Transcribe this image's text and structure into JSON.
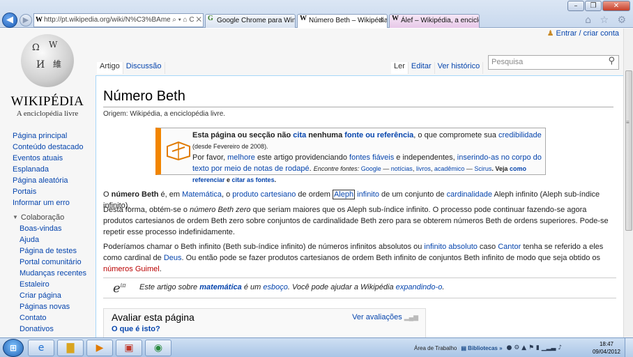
{
  "browser": {
    "address": "http://pt.wikipedia.org/wiki/N%C3%BAmero_Be",
    "address_controls": "⌕ ▾ ⌂ C ✕",
    "tabs": [
      {
        "label": "Google Chrome para Window...",
        "icon": "G"
      },
      {
        "label": "Número Beth – Wikipédia, ...",
        "icon": "W",
        "close": "✕"
      },
      {
        "label": "Álef – Wikipédia, a enciclopédi...",
        "icon": "W"
      }
    ],
    "toolbar_icons": "⌂ ☆ ⚙"
  },
  "wiki": {
    "wordmark": "WIKIPÉDIA",
    "tagline": "A enciclopédia livre",
    "user_link": "Entrar / criar conta",
    "left_tabs": [
      "Artigo",
      "Discussão"
    ],
    "right_tabs": [
      "Ler",
      "Editar",
      "Ver histórico"
    ],
    "search_placeholder": "Pesquisa",
    "sidebar": {
      "main": [
        "Página principal",
        "Conteúdo destacado",
        "Eventos atuais",
        "Esplanada",
        "Página aleatória",
        "Portais",
        "Informar um erro"
      ],
      "collab_header": "Colaboração",
      "collab": [
        "Boas-vindas",
        "Ajuda",
        "Página de testes",
        "Portal comunitário",
        "Mudanças recentes",
        "Estaleiro",
        "Criar página",
        "Páginas novas",
        "Contato",
        "Donativos"
      ]
    }
  },
  "article": {
    "title": "Número Beth",
    "origin": "Origem: Wikipédia, a enciclopédia livre.",
    "ambox": {
      "b1": "Esta página ou secção não ",
      "l1": "cita",
      "b2": " nenhuma ",
      "l2": "fonte ou referência",
      "t1": ", o que compromete sua ",
      "l3": "credibilidade",
      "small1": "(desde Fevereiro de 2008).",
      "t2": "Por favor, ",
      "l4": "melhore",
      "t3": " este artigo providenciando ",
      "l5": "fontes fiáveis",
      "t4": " e independentes, ",
      "l6": "inserindo-as no corpo do texto por meio de notas de rodapé",
      "t5": ". ",
      "s_enc": "Encontre fontes: ",
      "s_google": "Google",
      "s_dash1": " — ",
      "s_news": "notícias",
      "s_c1": ", ",
      "s_books": "livros",
      "s_c2": ", ",
      "s_acad": "acadêmico",
      "s_dash2": " — ",
      "s_scirus": "Scirus",
      "s_veja": ". Veja ",
      "s_como": "como referenciar",
      "s_e": " e ",
      "s_citar": "citar as fontes",
      "s_end": "."
    },
    "p1": {
      "a": "O ",
      "b": "número Beth",
      "c": " é, em ",
      "l1": "Matemática",
      "d": ", o ",
      "l2": "produto cartesiano",
      "e": " de ordem ",
      "l3": "Aleph",
      "f": " ",
      "l4": "infinito",
      "g": " de um conjunto de ",
      "l5": "cardinalidade",
      "h": " Aleph infinito (Aleph sub-índice infinito)."
    },
    "p2": {
      "a": "Desta forma, obtém-se o ",
      "i": "número Beth zero",
      "b": " que seriam maiores que os Aleph sub-índice infinito. O processo pode continuar fazendo-se agora produtos cartesianos de ordem Beth zero sobre conjuntos de cardinalidade Beth zero para se obterem números Beth de ordens superiores. Pode-se repetir esse processo indefinidamente."
    },
    "p3": {
      "a": "Poderíamos chamar o Beth infinito (Beth sub-índice infinito) de números infinitos absolutos ou ",
      "l1": "infinito absoluto",
      "b": " caso ",
      "l2": "Cantor",
      "c": " tenha se referido a eles como cardinal de ",
      "l3": "Deus",
      "d": ". Ou então pode se fazer produtos cartesianos de ordem Beth infinito de conjuntos Beth infinito de modo que seja obtido os ",
      "l4": "números Guimel",
      "e": "."
    },
    "stub": {
      "a": "Este artigo sobre ",
      "b": "matemática",
      "c": " é um ",
      "l1": "esboço",
      "d": ". Você pode ajudar a Wikipédia ",
      "l2": "expandindo-o",
      "e": "."
    },
    "rate": {
      "title": "Avaliar esta página",
      "what": "O que é isto?",
      "view": "Ver avaliações"
    }
  },
  "taskbar": {
    "desktop": "Área de Trabalho",
    "libs": "Bibliotecas",
    "time": "18:47",
    "date": "09/04/2012"
  }
}
